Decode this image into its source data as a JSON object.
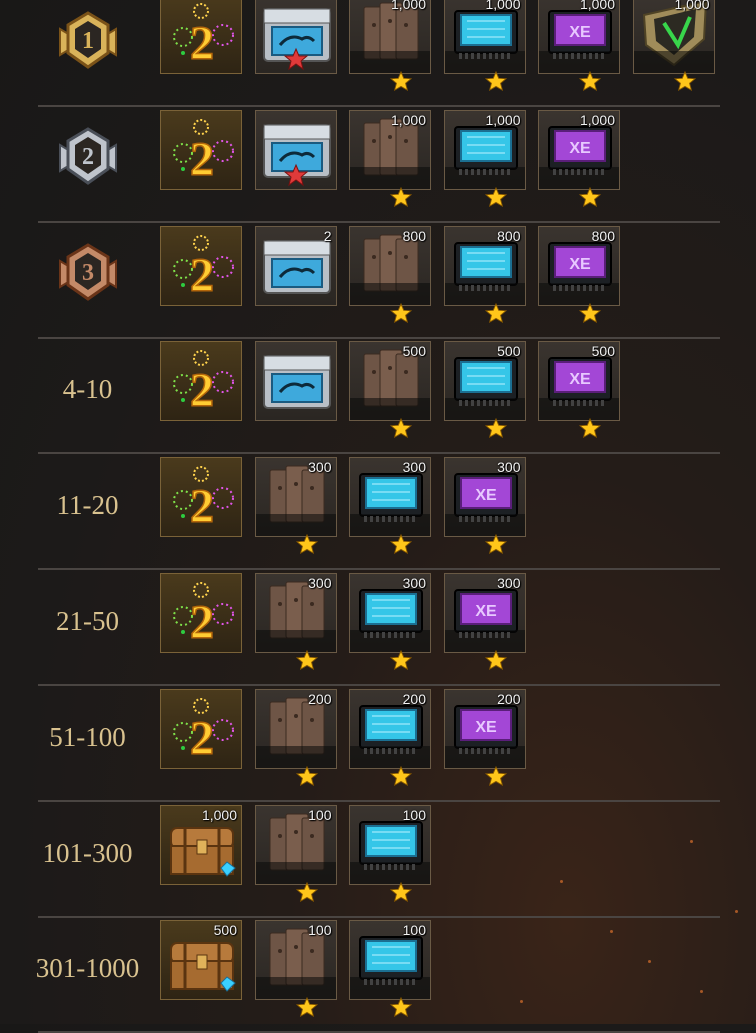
{
  "rows": [
    {
      "rank": "",
      "badge": "gold-rank-1",
      "items": [
        {
          "icon": "fireworks-2-icon",
          "qty": ""
        },
        {
          "icon": "supply-crate-red-star-icon",
          "qty": ""
        },
        {
          "icon": "armor-plates-icon",
          "qty": "1,000"
        },
        {
          "icon": "blue-chip-icon",
          "qty": "1,000"
        },
        {
          "icon": "purple-chip-icon",
          "qty": "1,000"
        },
        {
          "icon": "green-emblem-icon",
          "qty": "1,000"
        }
      ]
    },
    {
      "rank": "",
      "badge": "silver-rank-2",
      "items": [
        {
          "icon": "fireworks-2-icon",
          "qty": ""
        },
        {
          "icon": "supply-crate-red-star-icon",
          "qty": ""
        },
        {
          "icon": "armor-plates-icon",
          "qty": "1,000"
        },
        {
          "icon": "blue-chip-icon",
          "qty": "1,000"
        },
        {
          "icon": "purple-chip-icon",
          "qty": "1,000"
        }
      ]
    },
    {
      "rank": "",
      "badge": "bronze-rank-3",
      "items": [
        {
          "icon": "fireworks-2-icon",
          "qty": ""
        },
        {
          "icon": "supply-crate-icon",
          "qty": "2"
        },
        {
          "icon": "armor-plates-icon",
          "qty": "800"
        },
        {
          "icon": "blue-chip-icon",
          "qty": "800"
        },
        {
          "icon": "purple-chip-icon",
          "qty": "800"
        }
      ]
    },
    {
      "rank": "4-10",
      "badge": "",
      "items": [
        {
          "icon": "fireworks-2-icon",
          "qty": ""
        },
        {
          "icon": "supply-crate-icon",
          "qty": ""
        },
        {
          "icon": "armor-plates-icon",
          "qty": "500"
        },
        {
          "icon": "blue-chip-icon",
          "qty": "500"
        },
        {
          "icon": "purple-chip-icon",
          "qty": "500"
        }
      ]
    },
    {
      "rank": "11-20",
      "badge": "",
      "items": [
        {
          "icon": "fireworks-2-icon",
          "qty": ""
        },
        {
          "icon": "armor-plates-icon",
          "qty": "300"
        },
        {
          "icon": "blue-chip-icon",
          "qty": "300"
        },
        {
          "icon": "purple-chip-icon",
          "qty": "300"
        }
      ]
    },
    {
      "rank": "21-50",
      "badge": "",
      "items": [
        {
          "icon": "fireworks-2-icon",
          "qty": ""
        },
        {
          "icon": "armor-plates-icon",
          "qty": "300"
        },
        {
          "icon": "blue-chip-icon",
          "qty": "300"
        },
        {
          "icon": "purple-chip-icon",
          "qty": "300"
        }
      ]
    },
    {
      "rank": "51-100",
      "badge": "",
      "items": [
        {
          "icon": "fireworks-2-icon",
          "qty": ""
        },
        {
          "icon": "armor-plates-icon",
          "qty": "200"
        },
        {
          "icon": "blue-chip-icon",
          "qty": "200"
        },
        {
          "icon": "purple-chip-icon",
          "qty": "200"
        }
      ]
    },
    {
      "rank": "101-300",
      "badge": "",
      "items": [
        {
          "icon": "treasure-chest-icon",
          "qty": "1,000"
        },
        {
          "icon": "armor-plates-icon",
          "qty": "100"
        },
        {
          "icon": "blue-chip-icon",
          "qty": "100"
        }
      ]
    },
    {
      "rank": "301-1000",
      "badge": "",
      "items": [
        {
          "icon": "treasure-chest-icon",
          "qty": "500"
        },
        {
          "icon": "armor-plates-icon",
          "qty": "100"
        },
        {
          "icon": "blue-chip-icon",
          "qty": "100"
        }
      ]
    }
  ]
}
